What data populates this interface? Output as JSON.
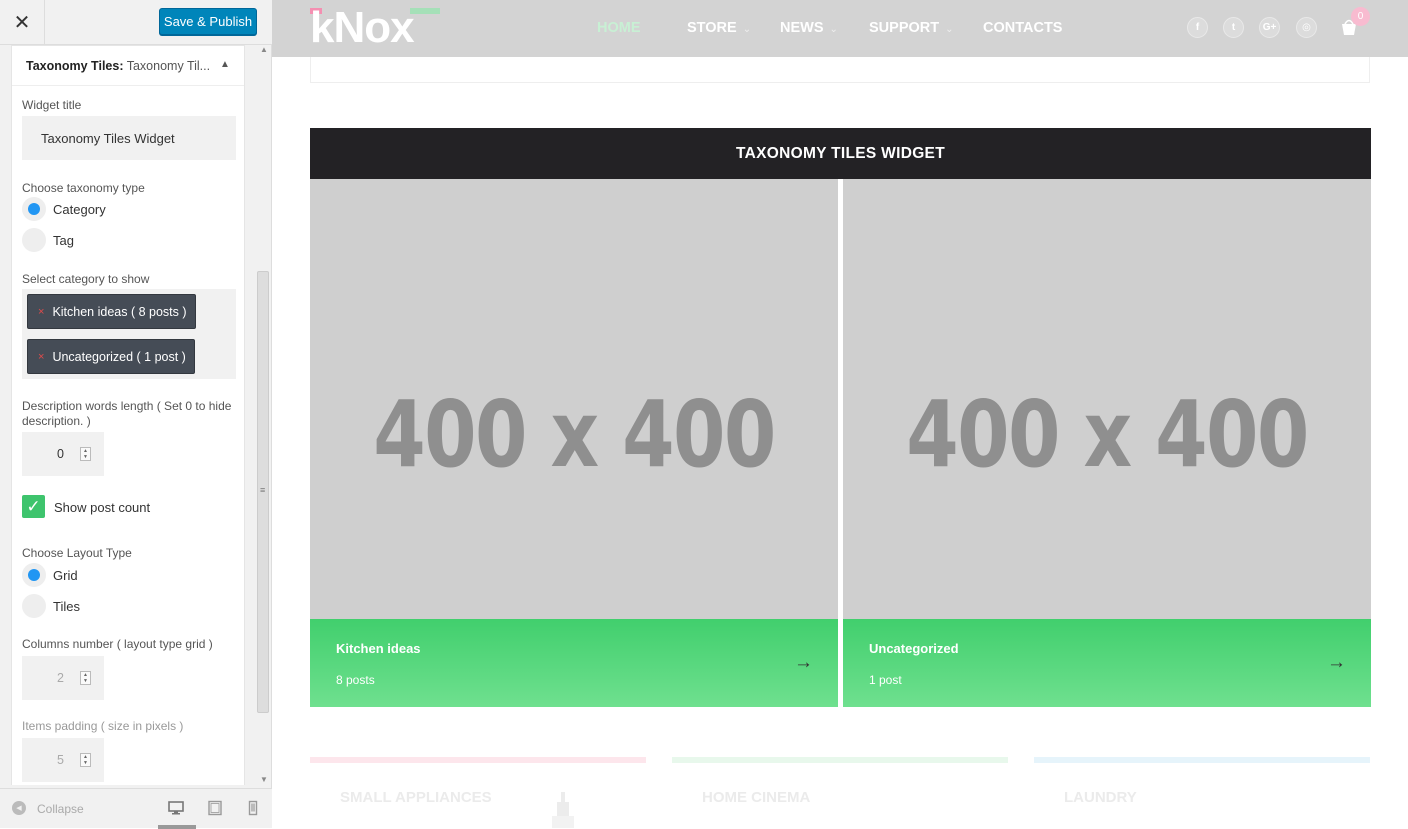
{
  "customizer": {
    "close_glyph": "✕",
    "publish_label": "Save & Publish",
    "widget": {
      "title_bold": "Taxonomy Tiles:",
      "title_sub": " Taxonomy Til...",
      "toggle_glyph": "▲",
      "fields": {
        "widget_title_label": "Widget title",
        "widget_title_value": "Taxonomy Tiles Widget",
        "taxonomy_type_label": "Choose taxonomy type",
        "taxonomy_options": [
          "Category",
          "Tag"
        ],
        "taxonomy_selected": "Category",
        "category_label": "Select category to show",
        "categories_selected": [
          {
            "remove_glyph": "×",
            "label": "Kitchen ideas ( 8 posts )"
          },
          {
            "remove_glyph": "×",
            "label": "Uncategorized ( 1 post )"
          }
        ],
        "desc_length_label": "Description words length ( Set 0 to hide description. )",
        "desc_length_value": "0",
        "show_post_count_label": "Show post count",
        "show_post_count_checked": true,
        "check_glyph": "✓",
        "layout_type_label": "Choose Layout Type",
        "layout_options": [
          "Grid",
          "Tiles"
        ],
        "layout_selected": "Grid",
        "columns_label": "Columns number ( layout type grid )",
        "columns_value": "2",
        "padding_label": "Items padding ( size in pixels )",
        "padding_value": "5",
        "spin_up": "▲",
        "spin_down": "▼"
      }
    },
    "footer": {
      "collapse_glyph": "◀",
      "collapse_label": "Collapse",
      "devices": [
        "desktop-icon",
        "tablet-icon",
        "mobile-icon"
      ],
      "active_device": "desktop"
    },
    "scrollbar": {
      "up_glyph": "▲",
      "down_glyph": "▼",
      "grip_glyph": "≡"
    }
  },
  "site": {
    "logo_text": "kNox",
    "nav": [
      {
        "label": "HOME",
        "active": true,
        "caret": ""
      },
      {
        "label": "STORE",
        "active": false,
        "caret": "⌄"
      },
      {
        "label": "NEWS",
        "active": false,
        "caret": "⌄"
      },
      {
        "label": "SUPPORT",
        "active": false,
        "caret": "⌄"
      },
      {
        "label": "CONTACTS",
        "active": false,
        "caret": ""
      }
    ],
    "social": [
      {
        "icon": "facebook-icon",
        "glyph": "f"
      },
      {
        "icon": "twitter-icon",
        "glyph": "t"
      },
      {
        "icon": "google-plus-icon",
        "glyph": "G+"
      },
      {
        "icon": "instagram-icon",
        "glyph": "◎"
      }
    ],
    "cart_count": "0",
    "widget_title": "TAXONOMY TILES WIDGET",
    "tiles": [
      {
        "placeholder": "400 x 400",
        "name": "Kitchen ideas",
        "count": "8 posts",
        "arrow": "→"
      },
      {
        "placeholder": "400 x 400",
        "name": "Uncategorized",
        "count": "1 post",
        "arrow": "→"
      }
    ],
    "bottom_categories": [
      "SMALL APPLIANCES",
      "HOME CINEMA",
      "LAUNDRY"
    ]
  },
  "colors": {
    "publish_blue": "#0085ba",
    "radio_blue": "#2196f3",
    "check_green": "#3ec46d",
    "tile_green": "#41cf6d",
    "banner_dark": "#232225",
    "chip_dark": "#454c56"
  }
}
